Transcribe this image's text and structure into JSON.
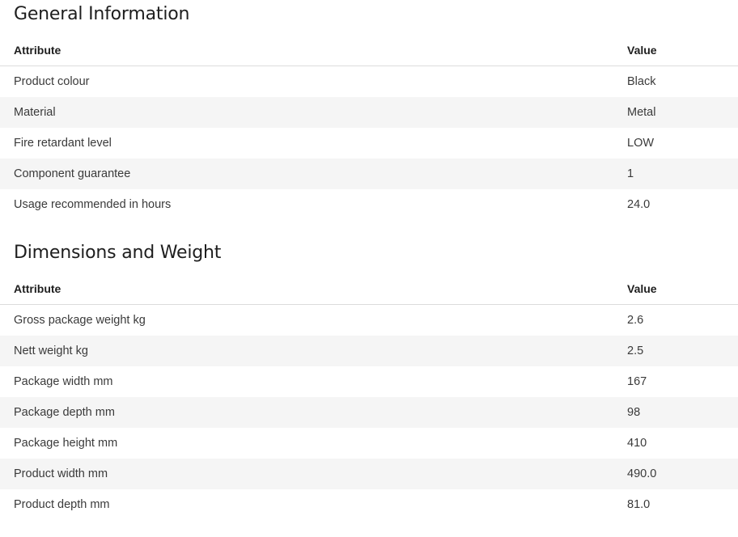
{
  "general": {
    "title": "General Information",
    "header_attribute": "Attribute",
    "header_value": "Value",
    "rows": [
      {
        "attribute": "Product colour",
        "value": "Black"
      },
      {
        "attribute": "Material",
        "value": "Metal"
      },
      {
        "attribute": "Fire retardant level",
        "value": "LOW"
      },
      {
        "attribute": "Component guarantee",
        "value": "1"
      },
      {
        "attribute": "Usage recommended in hours",
        "value": "24.0"
      }
    ]
  },
  "dimensions": {
    "title": "Dimensions and Weight",
    "header_attribute": "Attribute",
    "header_value": "Value",
    "rows": [
      {
        "attribute": "Gross package weight kg",
        "value": "2.6"
      },
      {
        "attribute": "Nett weight kg",
        "value": "2.5"
      },
      {
        "attribute": "Package width mm",
        "value": "167"
      },
      {
        "attribute": "Package depth mm",
        "value": "98"
      },
      {
        "attribute": "Package height mm",
        "value": "410"
      },
      {
        "attribute": "Product width mm",
        "value": "490.0"
      },
      {
        "attribute": "Product depth mm",
        "value": "81.0"
      }
    ]
  }
}
